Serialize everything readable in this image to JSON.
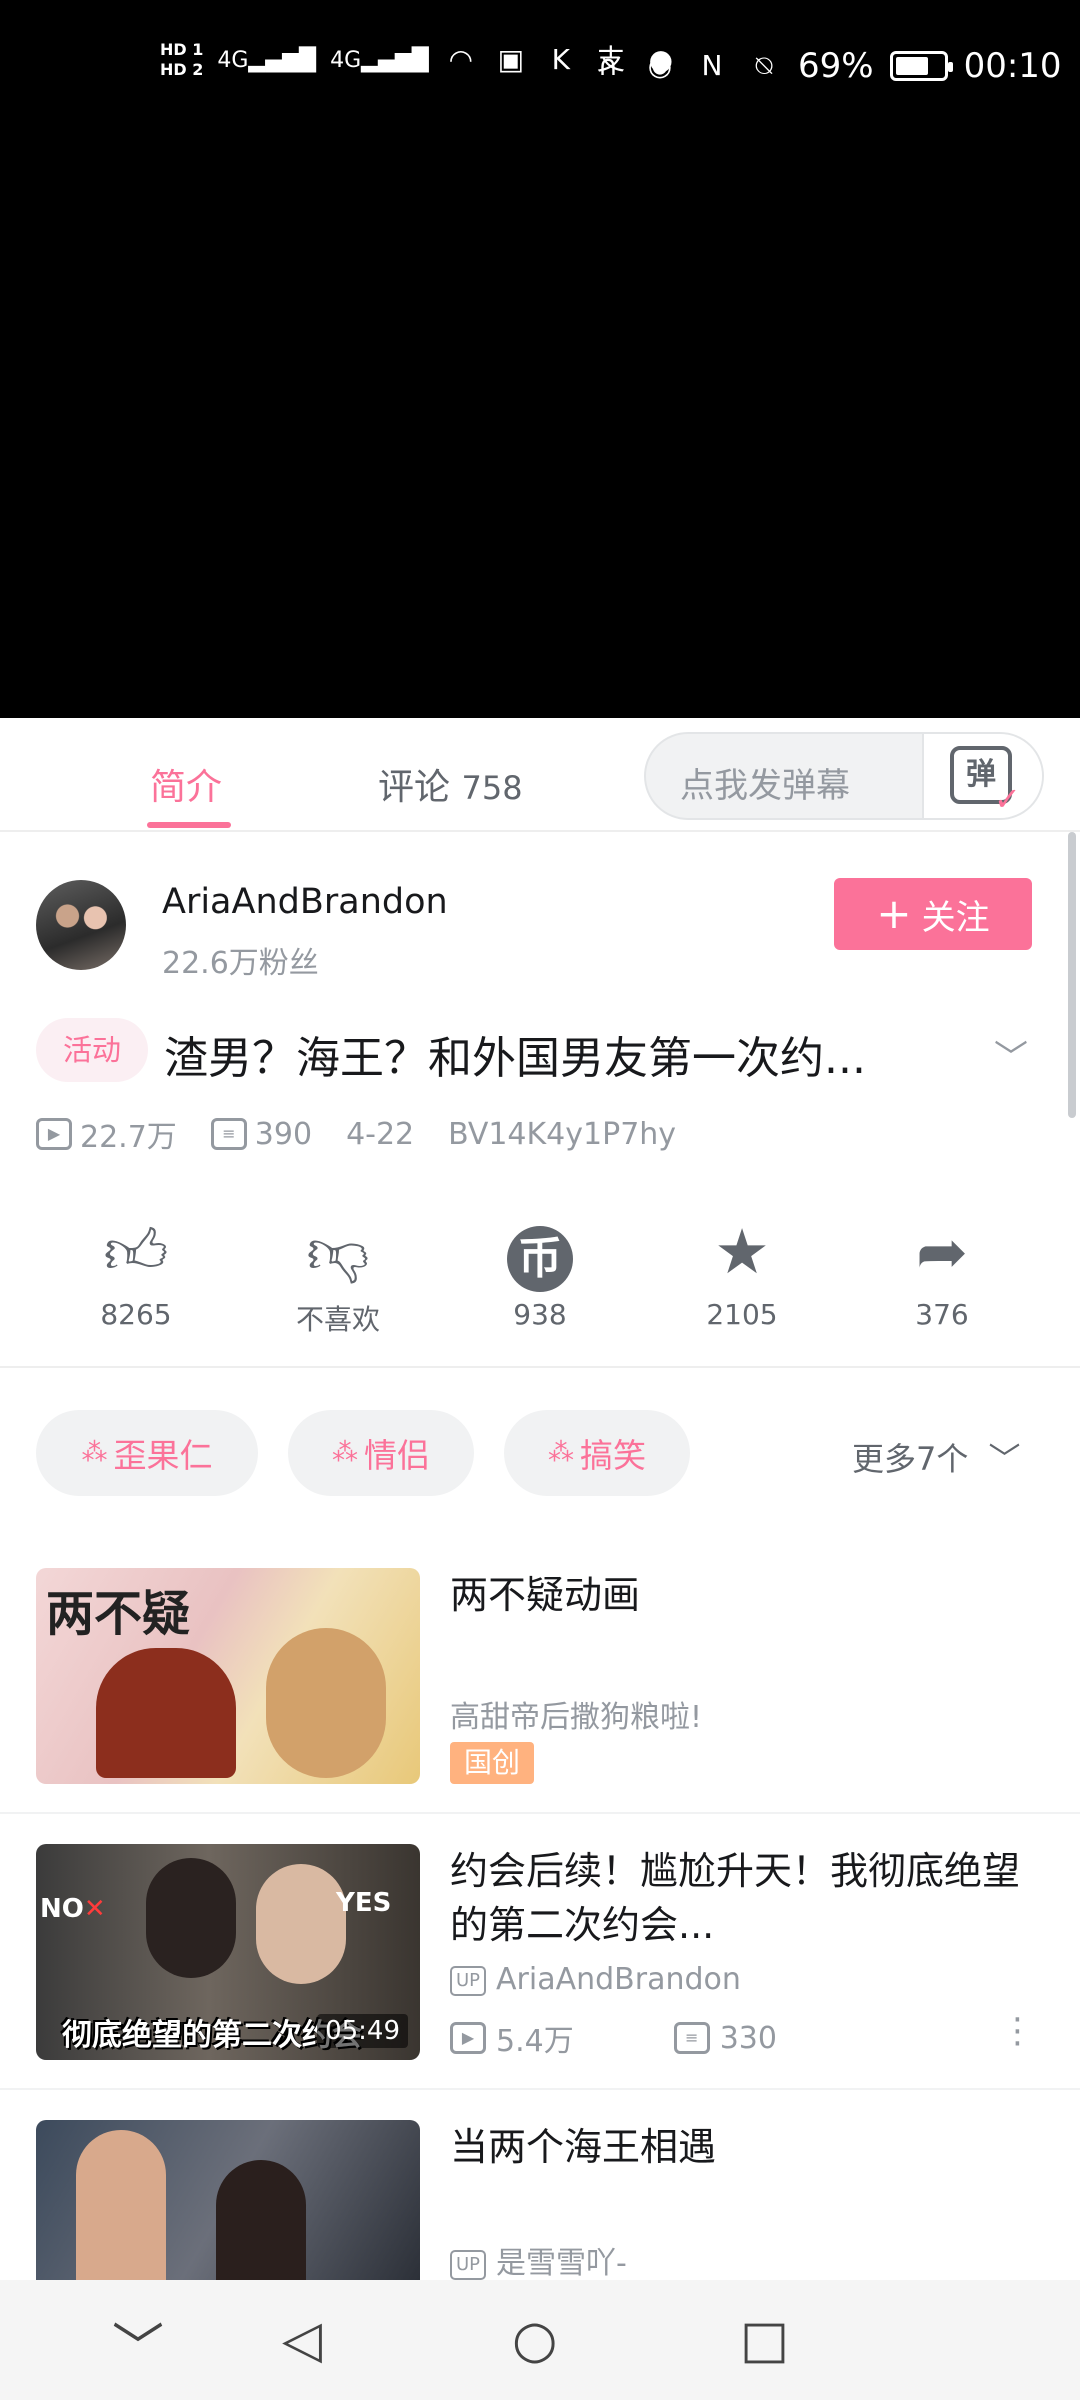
{
  "status_bar": {
    "sim1": "HD 1",
    "sim2": "HD 2",
    "signal": "4G",
    "battery": "69%",
    "battery_level": 0.69,
    "time": "00:10",
    "icons": [
      "signal-icon",
      "wifi-icon",
      "tv-icon",
      "k-icon",
      "alipay-icon",
      "chat-icon",
      "headphone-icon",
      "eye-icon",
      "nfc-icon",
      "mute-icon"
    ]
  },
  "tabs": {
    "intro": "简介",
    "comments": "评论",
    "comments_count": "758",
    "danmaku_placeholder": "点我发弹幕",
    "danmaku_icon_text": "弹"
  },
  "uploader": {
    "name": "AriaAndBrandon",
    "fans": "22.6万粉丝",
    "follow_label": "关注"
  },
  "video": {
    "badge": "活动",
    "title": "渣男？海王？和外国男友第一次约...",
    "views": "22.7万",
    "danmaku": "390",
    "date": "4-22",
    "bvid": "BV14K4y1P7hy"
  },
  "actions": [
    {
      "name": "like",
      "label": "8265"
    },
    {
      "name": "dislike",
      "label": "不喜欢"
    },
    {
      "name": "coin",
      "label": "938"
    },
    {
      "name": "favorite",
      "label": "2105"
    },
    {
      "name": "share",
      "label": "376"
    }
  ],
  "tags": [
    "歪果仁",
    "情侣",
    "搞笑"
  ],
  "more_tags": "更多7个",
  "recommendations": [
    {
      "title": "两不疑动画",
      "subtitle": "高甜帝后撒狗粮啦!",
      "badge": "国创",
      "thumb_text": "两不疑"
    },
    {
      "title": "约会后续！尴尬升天！我彻底绝望的第二次约会...",
      "uploader": "AriaAndBrandon",
      "views": "5.4万",
      "danmaku": "330",
      "duration": "05:49",
      "thumb_text": "彻底绝望的第二次约会",
      "thumb_no": "NO",
      "thumb_yes": "YES"
    },
    {
      "title": "当两个海王相遇",
      "uploader": "是雪雪吖-"
    }
  ],
  "up_label": "UP",
  "colors": {
    "accent": "#fb7299",
    "muted": "#9499a0",
    "badge_orange": "#ffb27f"
  }
}
